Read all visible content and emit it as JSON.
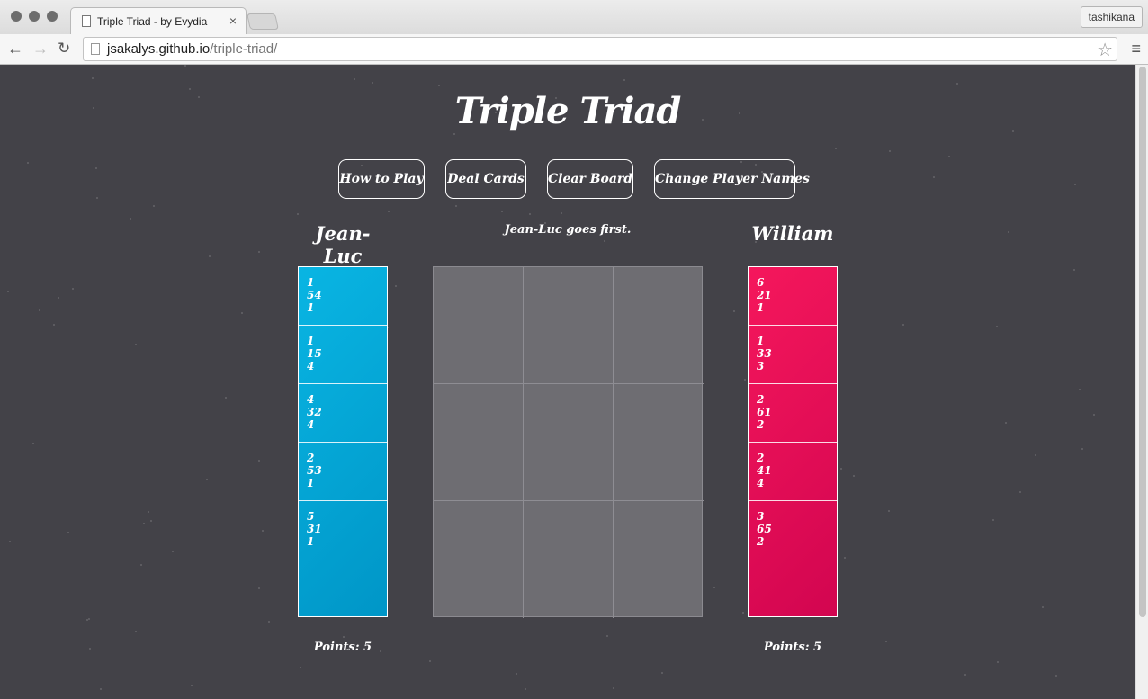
{
  "browser": {
    "tab_title": "Triple Triad - by Evydia",
    "tab_close": "×",
    "profile_name": "tashikana",
    "url_host": "jsakalys.github.io",
    "url_path": "/triple-triad/",
    "back_glyph": "←",
    "forward_glyph": "→",
    "reload_glyph": "↻",
    "star_glyph": "☆",
    "menu_glyph": "≡"
  },
  "game": {
    "title": "Triple Triad",
    "buttons": {
      "how_to_play": "How to Play",
      "deal_cards": "Deal Cards",
      "clear_board": "Clear Board",
      "change_names": "Change Player Names"
    },
    "status": "Jean-Luc goes first.",
    "player1": {
      "name": "Jean-Luc",
      "points": "Points: 5",
      "color": "#09b5e3",
      "cards": [
        {
          "top": "1",
          "middle": "54",
          "bottom": "1"
        },
        {
          "top": "1",
          "middle": "15",
          "bottom": "4"
        },
        {
          "top": "4",
          "middle": "32",
          "bottom": "4"
        },
        {
          "top": "2",
          "middle": "53",
          "bottom": "1"
        },
        {
          "top": "5",
          "middle": "31",
          "bottom": "1"
        }
      ]
    },
    "player2": {
      "name": "William",
      "points": "Points: 5",
      "color": "#f5175c",
      "cards": [
        {
          "top": "6",
          "middle": "21",
          "bottom": "1"
        },
        {
          "top": "1",
          "middle": "33",
          "bottom": "3"
        },
        {
          "top": "2",
          "middle": "61",
          "bottom": "2"
        },
        {
          "top": "2",
          "middle": "41",
          "bottom": "4"
        },
        {
          "top": "3",
          "middle": "65",
          "bottom": "2"
        }
      ]
    },
    "board_cells": 9
  }
}
